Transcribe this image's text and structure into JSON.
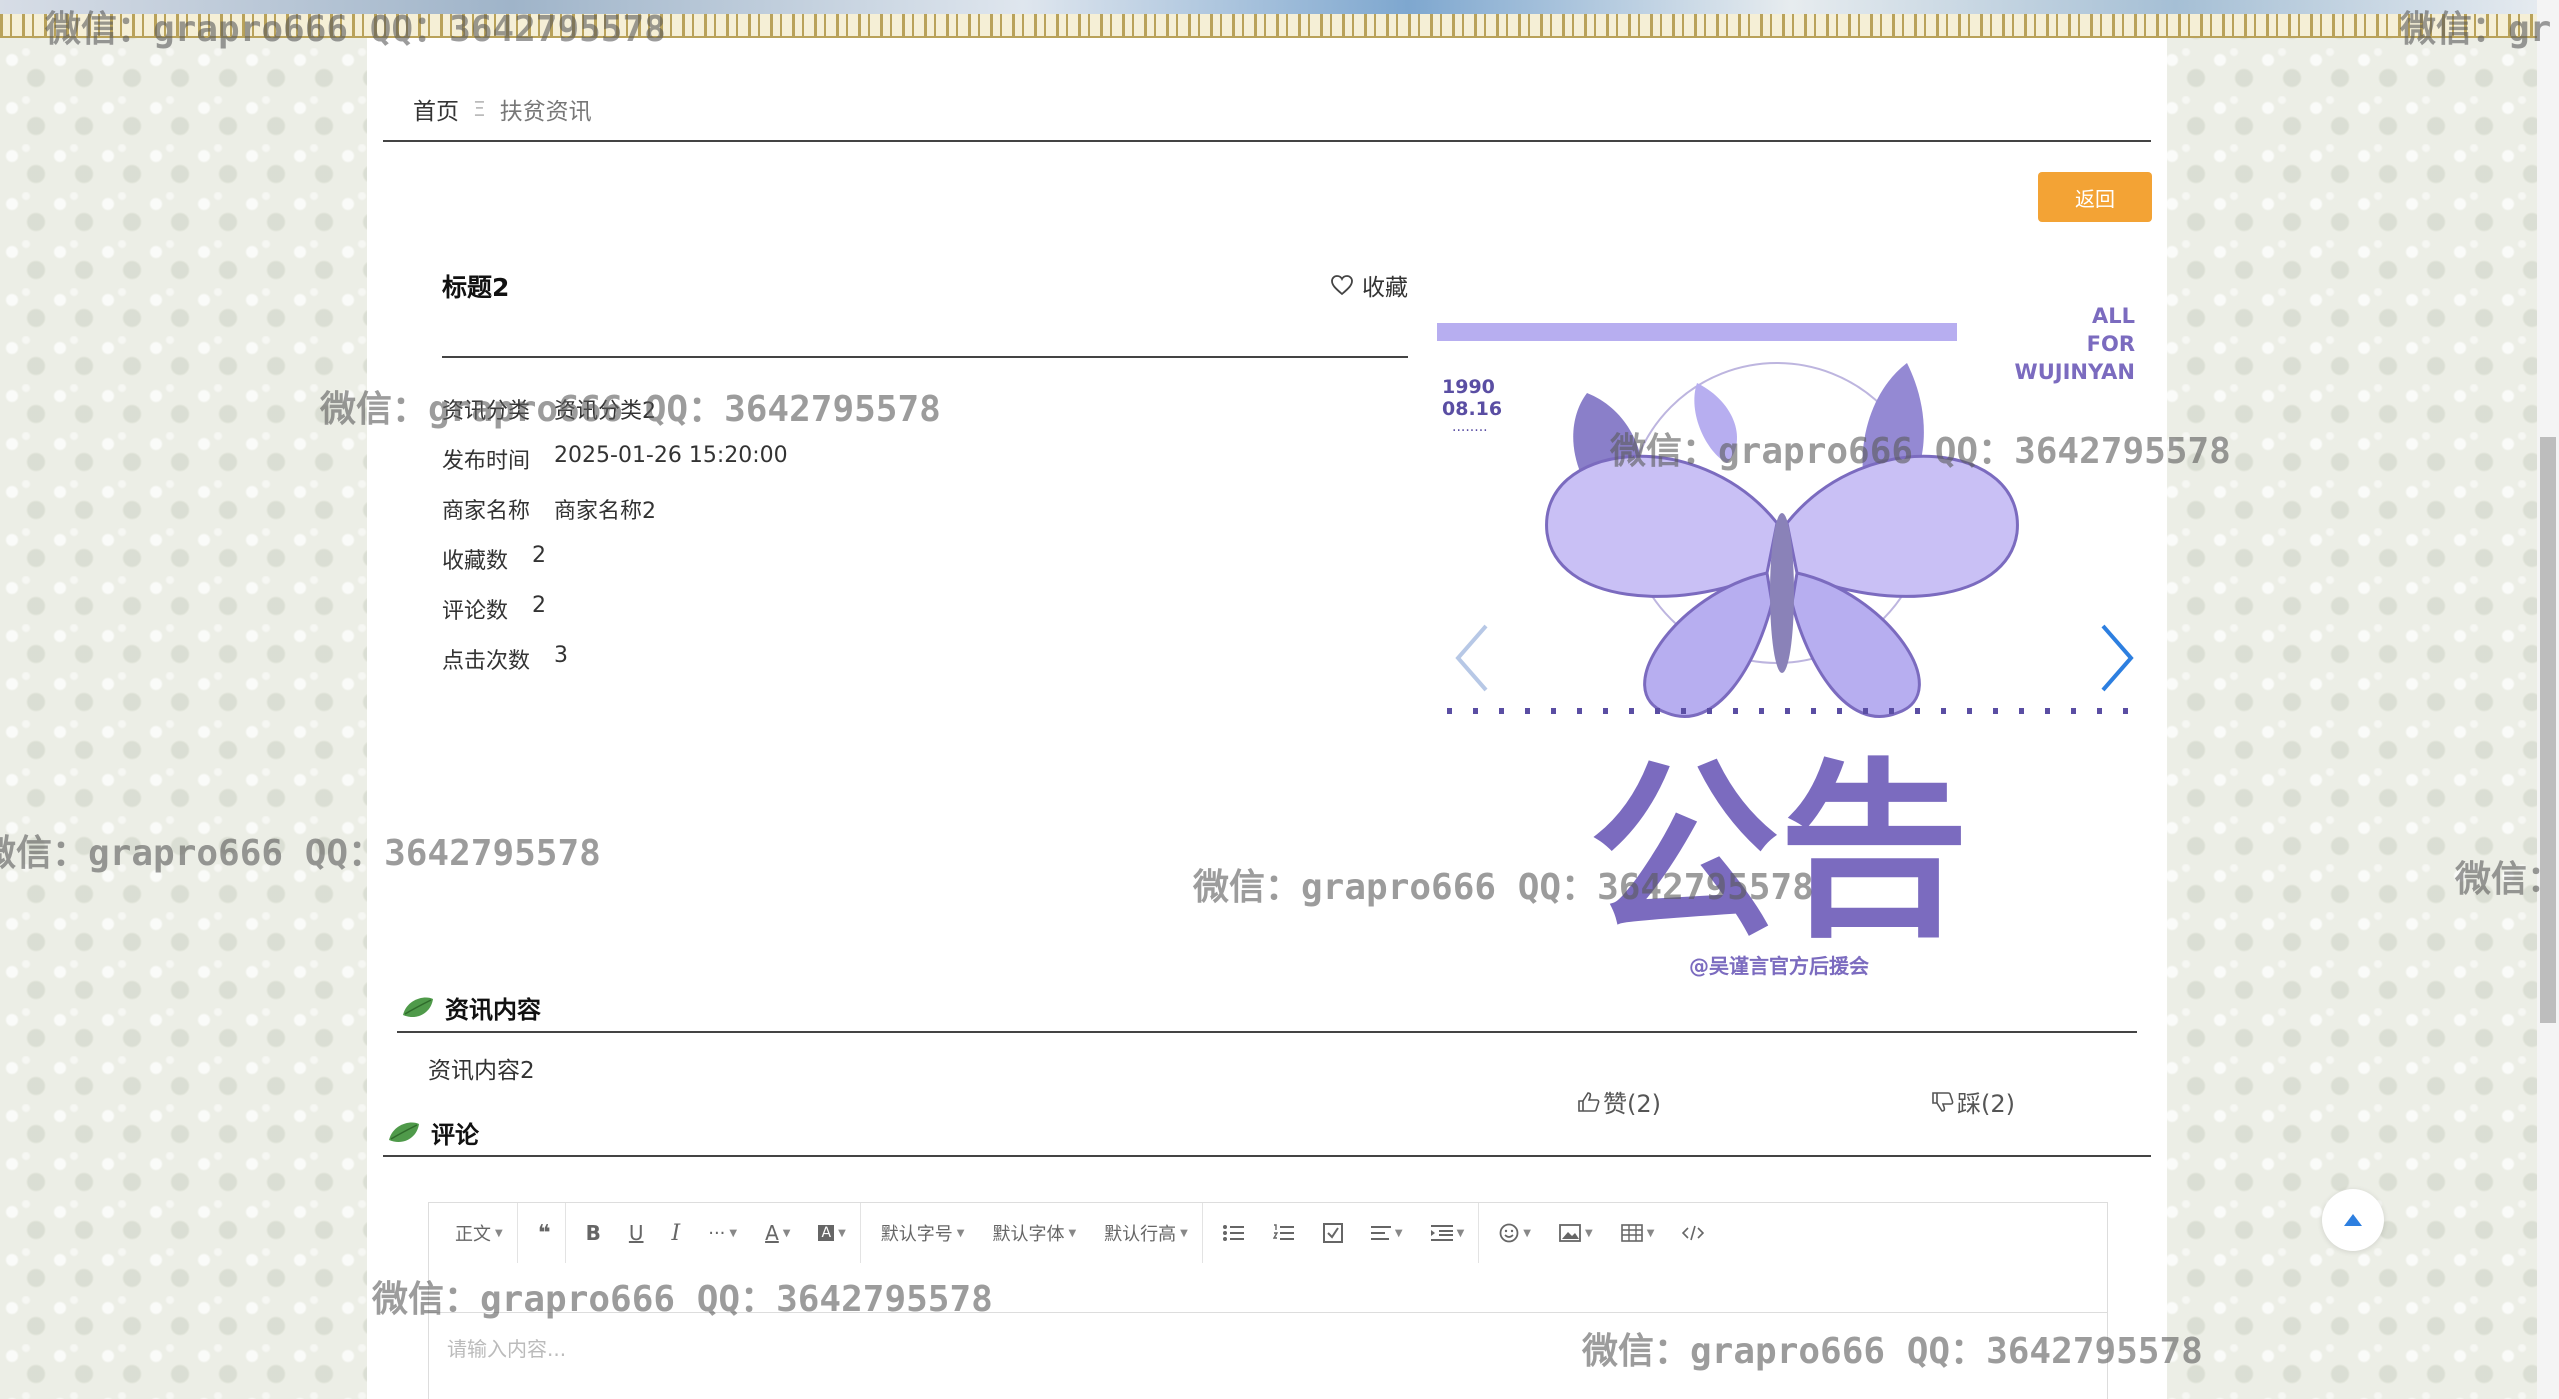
{
  "breadcrumb": {
    "home": "首页",
    "separator": "Ξ",
    "current": "扶贫资讯"
  },
  "back_button": "返回",
  "article": {
    "title": "标题2",
    "favorite_label": "收藏",
    "fields": [
      {
        "key": "资讯分类",
        "value": "资讯分类2"
      },
      {
        "key": "发布时间",
        "value": "2025-01-26 15:20:00"
      },
      {
        "key": "商家名称",
        "value": "商家名称2"
      },
      {
        "key": "收藏数",
        "value": "2"
      },
      {
        "key": "评论数",
        "value": "2"
      },
      {
        "key": "点击次数",
        "value": "3"
      }
    ]
  },
  "poster": {
    "corner_text": [
      "ALL",
      "FOR",
      "WUJINYAN"
    ],
    "date_lines": [
      "1990",
      "08.16"
    ],
    "dots_label": "········",
    "main_text": "公告",
    "footer_text": "@吴谨言官方后援会",
    "accent_color": "#7b6bbf",
    "light_color": "#b7aef0"
  },
  "content_section": {
    "title": "资讯内容",
    "text": "资讯内容2"
  },
  "votes": {
    "like": "赞(2)",
    "dislike": "踩(2)"
  },
  "comment_section": {
    "title": "评论"
  },
  "editor": {
    "toolbar": [
      "正文",
      "❝",
      "B",
      "U",
      "I",
      "···",
      "A",
      "A",
      "默认字号",
      "默认字体",
      "默认行高"
    ],
    "placeholder": "请输入内容..."
  },
  "watermarks": [
    "微信：grapro666 QQ：3642795578",
    "微信：grapro666 QQ：3642795578",
    "微信：grapro666 QQ：3642795578",
    "微信：grapro666 QQ：3642795578",
    "微信：grapro666 QQ：3642795578",
    "微信：grapro666 QQ：3642795578",
    "微信：grapro666 QQ：3642795578",
    "微信：gr",
    "微信："
  ]
}
